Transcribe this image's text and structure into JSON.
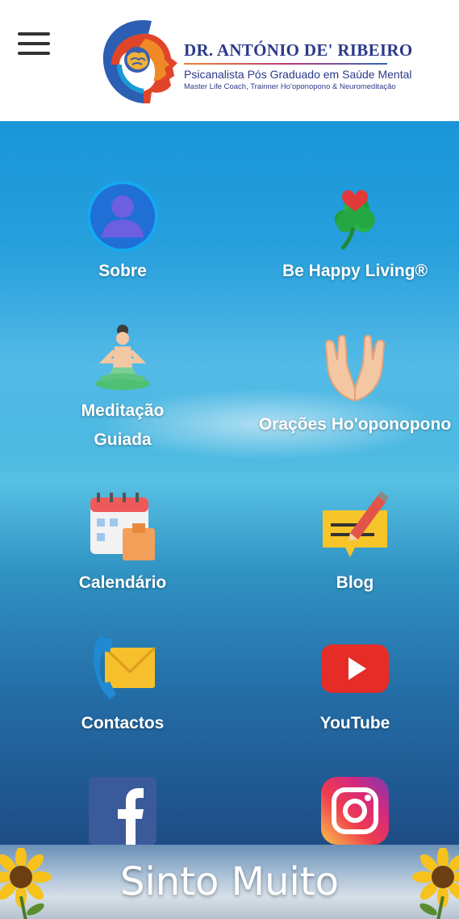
{
  "header": {
    "brand_name": "DR. ANTÓNIO DE' RIBEIRO",
    "subtitle": "Psicanalista Pós Graduado em Saúde Mental",
    "tagline": "Master Life Coach, Trainner Ho'oponopono & Neuromeditação"
  },
  "tiles": [
    {
      "label": "Sobre",
      "icon": "user-icon"
    },
    {
      "label": "Be Happy Living®",
      "icon": "clover-heart-icon"
    },
    {
      "label": "Meditação Guiada",
      "icon": "meditation-icon"
    },
    {
      "label": "Orações Ho'oponopono",
      "icon": "praying-hands-icon"
    },
    {
      "label": "Calendário",
      "icon": "calendar-icon"
    },
    {
      "label": "Blog",
      "icon": "blog-pencil-icon"
    },
    {
      "label": "Contactos",
      "icon": "phone-envelope-icon"
    },
    {
      "label": "YouTube",
      "icon": "youtube-icon"
    },
    {
      "label": "",
      "icon": "facebook-icon"
    },
    {
      "label": "",
      "icon": "instagram-icon"
    }
  ],
  "banner": {
    "text": "Sinto Muito"
  },
  "colors": {
    "brand": "#2c3a8a",
    "background_top": "#1a96d8",
    "background_bottom": "#1e4c85"
  }
}
